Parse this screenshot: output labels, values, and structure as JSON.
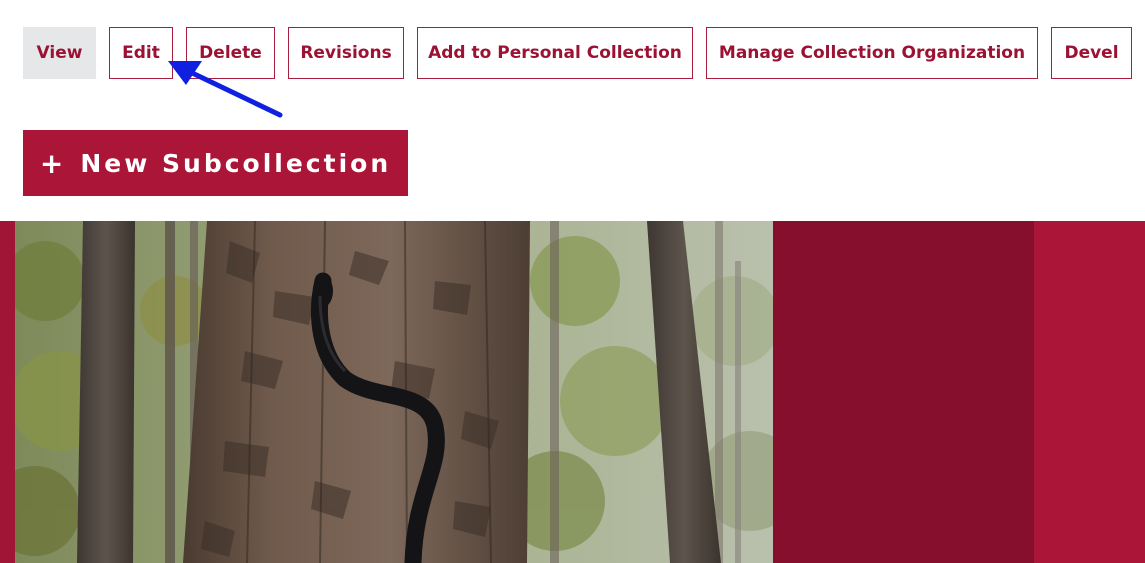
{
  "tabs": {
    "view": "View",
    "edit": "Edit",
    "delete": "Delete",
    "revisions": "Revisions",
    "add_personal": "Add to Personal Collection",
    "manage_org": "Manage Collection Organization",
    "devel": "Devel"
  },
  "actions": {
    "new_subcollection_icon": "+",
    "new_subcollection_label": "New Subcollection"
  },
  "hero": {
    "image_subject": "black snake climbing a pine tree in a forest"
  },
  "colors": {
    "brand_red": "#ab1537",
    "brand_dark_red": "#860f2e",
    "tab_text": "#9b1233",
    "active_tab_bg": "#e5e7e8",
    "annotation_arrow": "#1020e0"
  }
}
